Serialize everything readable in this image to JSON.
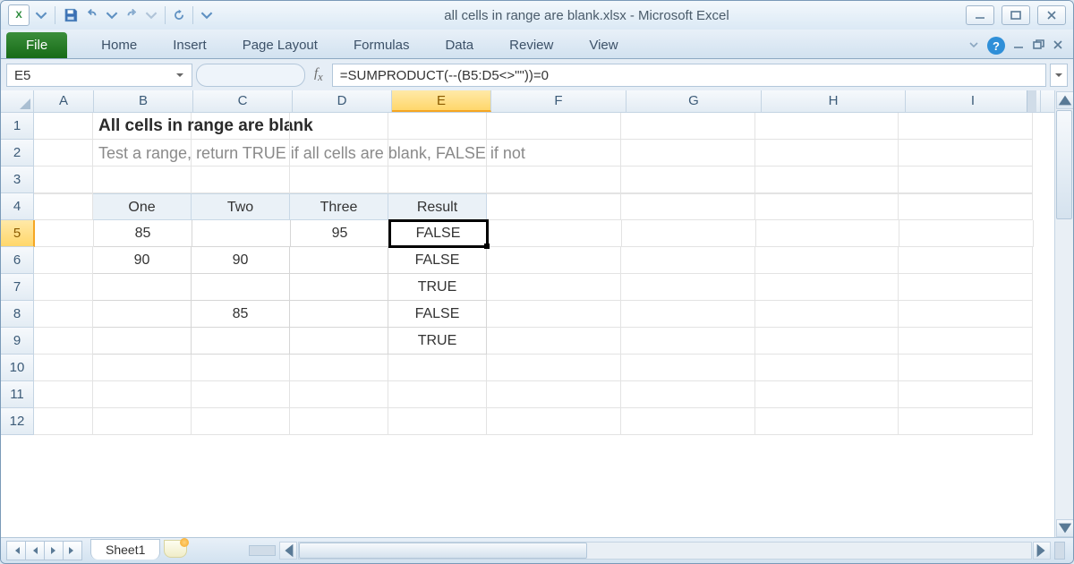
{
  "titlebar": {
    "title": "all cells in range are blank.xlsx  -  Microsoft Excel"
  },
  "ribbon": {
    "file": "File",
    "tabs": [
      "Home",
      "Insert",
      "Page Layout",
      "Formulas",
      "Data",
      "Review",
      "View"
    ]
  },
  "namebox": {
    "value": "E5"
  },
  "formula": {
    "value": "=SUMPRODUCT(--(B5:D5<>\"\"))=0"
  },
  "columns": [
    "A",
    "B",
    "C",
    "D",
    "E",
    "F",
    "G",
    "H",
    "I"
  ],
  "row_numbers": [
    "1",
    "2",
    "3",
    "4",
    "5",
    "6",
    "7",
    "8",
    "9",
    "10",
    "11",
    "12"
  ],
  "content": {
    "title": "All cells in range are blank",
    "subtitle": "Test a range, return TRUE if all cells are blank, FALSE if not",
    "headers": [
      "One",
      "Two",
      "Three",
      "Result"
    ],
    "rows": [
      {
        "one": "85",
        "two": "",
        "three": "95",
        "result": "FALSE"
      },
      {
        "one": "90",
        "two": "90",
        "three": "",
        "result": "FALSE"
      },
      {
        "one": "",
        "two": "",
        "three": "",
        "result": "TRUE"
      },
      {
        "one": "",
        "two": "85",
        "three": "",
        "result": "FALSE"
      },
      {
        "one": "",
        "two": "",
        "three": "",
        "result": "TRUE"
      }
    ]
  },
  "sheet": {
    "name": "Sheet1"
  }
}
